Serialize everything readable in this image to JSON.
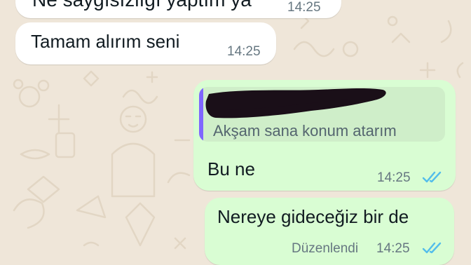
{
  "messages": [
    {
      "direction": "incoming",
      "text": "Ne saygısızlığı yaptım ya",
      "time": "14:25",
      "partially_cropped": true
    },
    {
      "direction": "incoming",
      "text": "Tamam alırım seni",
      "time": "14:25"
    },
    {
      "direction": "outgoing",
      "quoted": {
        "author_redacted": true,
        "text": "Akşam sana konum atarım"
      },
      "text": "Bu ne",
      "time": "14:25",
      "status": "read",
      "status_icon": "double-check-icon"
    },
    {
      "direction": "outgoing",
      "text": "Nereye gideceğiz bir de",
      "edited_label": "Düzenlendi",
      "time": "14:25",
      "status": "read",
      "status_icon": "double-check-icon"
    }
  ],
  "colors": {
    "wallpaper": "#efe6d9",
    "incoming_bubble": "#ffffff",
    "outgoing_bubble": "#d9fdd3",
    "quote_accent": "#7f66ff",
    "read_ticks": "#53bdeb",
    "timestamp": "#667781"
  }
}
